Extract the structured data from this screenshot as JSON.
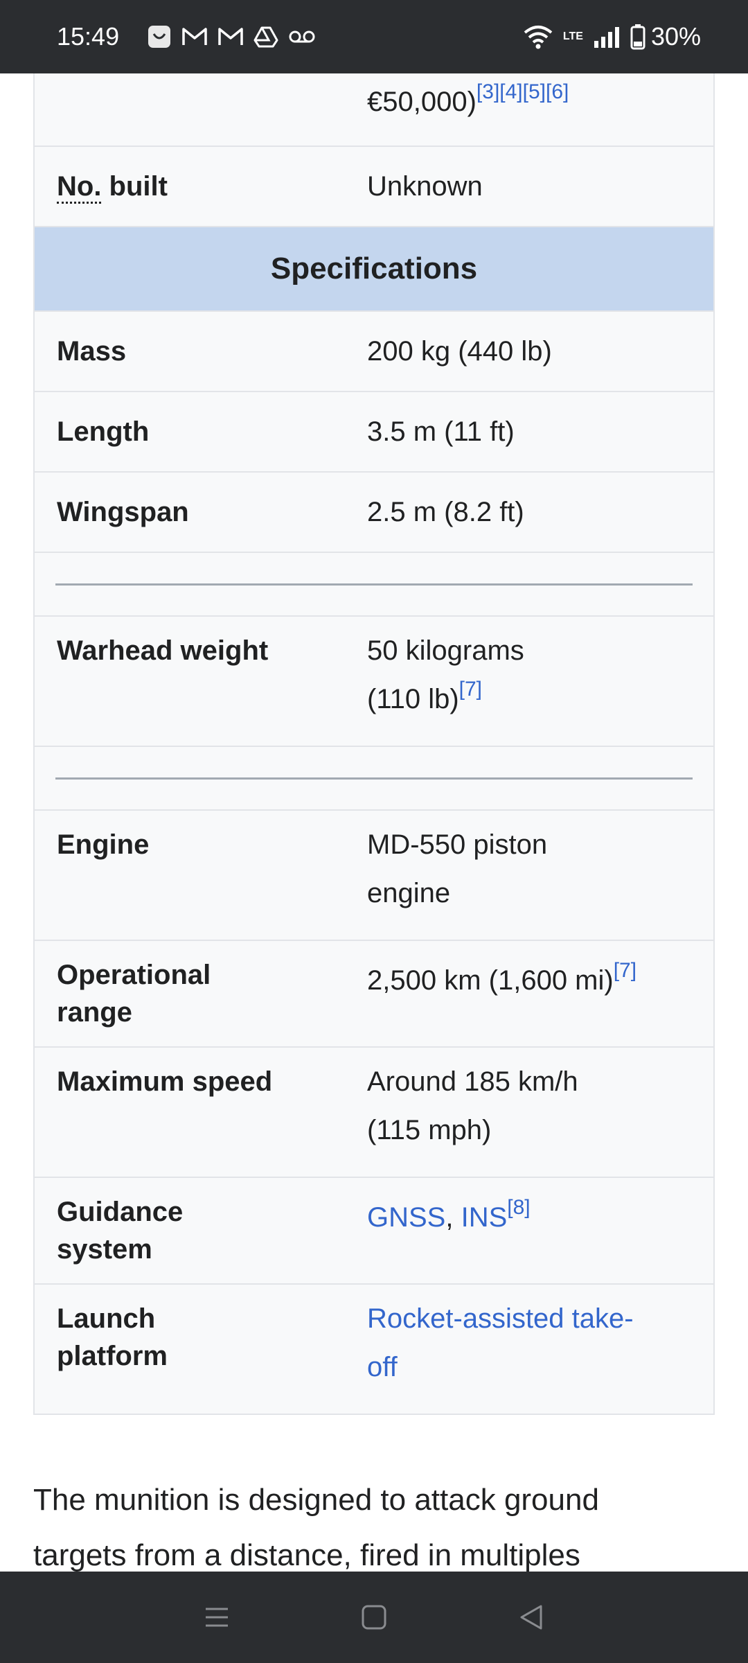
{
  "status_bar": {
    "time": "15:49",
    "battery": "30%",
    "volte": "LTE"
  },
  "infobox": {
    "top_value": {
      "text": "€50,000)",
      "refs": "[3][4][5][6]"
    },
    "no_built": {
      "abbr": "No.",
      "label_rest": " built",
      "value": "Unknown"
    },
    "section_header": "Specifications",
    "mass": {
      "label": "Mass",
      "value": "200 kg (440 lb)"
    },
    "length": {
      "label": "Length",
      "value": "3.5 m (11 ft)"
    },
    "wingspan": {
      "label": "Wingspan",
      "value": "2.5 m (8.2 ft)"
    },
    "warhead": {
      "label": "Warhead weight",
      "value_line1": "50 kilograms",
      "value_line2": "(110 lb)",
      "ref": "[7]"
    },
    "engine": {
      "label": "Engine",
      "value_line1": "MD-550 piston",
      "value_line2": "engine"
    },
    "range": {
      "label_line1": "Operational",
      "label_line2": "range",
      "value": "2,500 km (1,600 mi)",
      "ref": "[7]"
    },
    "speed": {
      "label": "Maximum speed",
      "value_line1": "Around 185 km/h",
      "value_line2": "(115 mph)"
    },
    "guidance": {
      "label_line1": "Guidance",
      "label_line2": "system",
      "link1": "GNSS",
      "sep": ", ",
      "link2": "INS",
      "ref": "[8]"
    },
    "launch": {
      "label_line1": "Launch",
      "label_line2": "platform",
      "link_line1": "Rocket-assisted take-",
      "link_line2": "off"
    }
  },
  "paragraph": {
    "line1": "The munition is designed to attack ground",
    "line2": "targets from a distance, fired in multiples"
  },
  "colors": {
    "status_bar": "#2b2d30",
    "header_bg": "#c4d6ee",
    "link": "#3366cc",
    "infobox_bg": "#f8f9fa"
  }
}
